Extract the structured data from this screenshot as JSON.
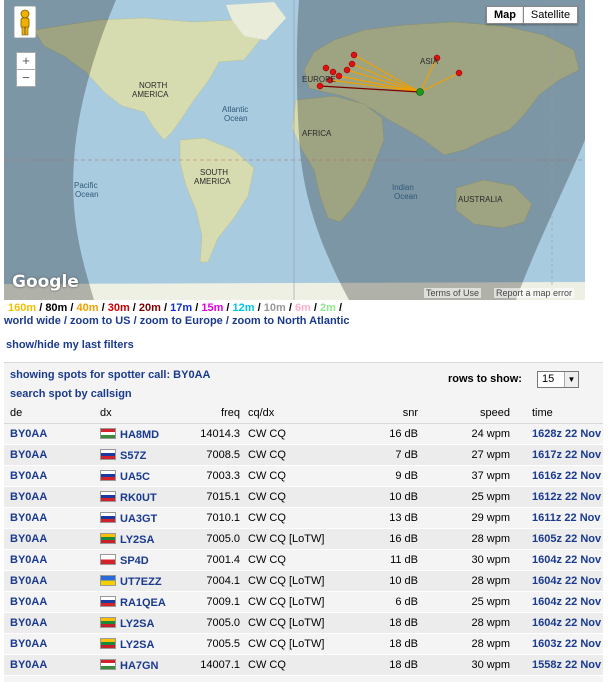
{
  "map": {
    "controls": {
      "map_label": "Map",
      "satellite_label": "Satellite",
      "zoom_in": "+",
      "zoom_out": "−"
    },
    "labels": {
      "north_america": "NORTH\nAMERICA",
      "atlantic_ocean": "Atlantic\nOcean",
      "south_america": "SOUTH\nAMERICA",
      "pacific_ocean": "Pacific\nOcean",
      "europe": "EUROPE",
      "africa": "AFRICA",
      "asia": "ASIA",
      "indian_ocean": "Indian\nOcean",
      "australia": "AUSTRALIA"
    },
    "logo_text": "Google",
    "terms": "Terms of Use",
    "report": "Report a map error"
  },
  "bands": [
    {
      "label": "160m",
      "color": "#f0c000"
    },
    {
      "label": "80m",
      "color": "#000000"
    },
    {
      "label": "40m",
      "color": "#f0a000"
    },
    {
      "label": "30m",
      "color": "#cc0000"
    },
    {
      "label": "20m",
      "color": "#7a0000"
    },
    {
      "label": "17m",
      "color": "#1030c0"
    },
    {
      "label": "15m",
      "color": "#e000e0"
    },
    {
      "label": "12m",
      "color": "#00c8e8"
    },
    {
      "label": "10m",
      "color": "#999999"
    },
    {
      "label": "6m",
      "color": "#ffb0c8"
    },
    {
      "label": "2m",
      "color": "#90e890"
    }
  ],
  "zoom_links": [
    "world wide",
    "zoom to US",
    "zoom to Europe",
    "zoom to North Atlantic"
  ],
  "filters_link": "show/hide my last filters",
  "panel": {
    "showing_spots": "showing spots for spotter call: BY0AA",
    "search_link": "search spot by callsign",
    "rows_label": "rows to show:",
    "rows_value": "15"
  },
  "table": {
    "headers": {
      "de": "de",
      "dx": "dx",
      "freq": "freq",
      "cq": "cq/dx",
      "snr": "snr",
      "speed": "speed",
      "time": "time"
    },
    "rows": [
      {
        "de": "BY0AA",
        "flag": "hu",
        "dx": "HA8MD",
        "freq": "14014.3",
        "cq": "CW CQ",
        "snr": "16 dB",
        "speed": "24 wpm",
        "time": "1628z 22 Nov"
      },
      {
        "de": "BY0AA",
        "flag": "si",
        "dx": "S57Z",
        "freq": "7008.5",
        "cq": "CW CQ",
        "snr": "7 dB",
        "speed": "27 wpm",
        "time": "1617z 22 Nov"
      },
      {
        "de": "BY0AA",
        "flag": "ru",
        "dx": "UA5C",
        "freq": "7003.3",
        "cq": "CW CQ",
        "snr": "9 dB",
        "speed": "37 wpm",
        "time": "1616z 22 Nov"
      },
      {
        "de": "BY0AA",
        "flag": "ru",
        "dx": "RK0UT",
        "freq": "7015.1",
        "cq": "CW CQ",
        "snr": "10 dB",
        "speed": "25 wpm",
        "time": "1612z 22 Nov"
      },
      {
        "de": "BY0AA",
        "flag": "ru",
        "dx": "UA3GT",
        "freq": "7010.1",
        "cq": "CW CQ",
        "snr": "13 dB",
        "speed": "29 wpm",
        "time": "1611z 22 Nov"
      },
      {
        "de": "BY0AA",
        "flag": "lt",
        "dx": "LY2SA",
        "freq": "7005.0",
        "cq": "CW CQ [LoTW]",
        "snr": "16 dB",
        "speed": "28 wpm",
        "time": "1605z 22 Nov"
      },
      {
        "de": "BY0AA",
        "flag": "pl",
        "dx": "SP4D",
        "freq": "7001.4",
        "cq": "CW CQ",
        "snr": "11 dB",
        "speed": "30 wpm",
        "time": "1604z 22 Nov"
      },
      {
        "de": "BY0AA",
        "flag": "ua",
        "dx": "UT7EZZ",
        "freq": "7004.1",
        "cq": "CW CQ [LoTW]",
        "snr": "10 dB",
        "speed": "28 wpm",
        "time": "1604z 22 Nov"
      },
      {
        "de": "BY0AA",
        "flag": "ru",
        "dx": "RA1QEA",
        "freq": "7009.1",
        "cq": "CW CQ [LoTW]",
        "snr": "6 dB",
        "speed": "25 wpm",
        "time": "1604z 22 Nov"
      },
      {
        "de": "BY0AA",
        "flag": "lt",
        "dx": "LY2SA",
        "freq": "7005.0",
        "cq": "CW CQ [LoTW]",
        "snr": "18 dB",
        "speed": "28 wpm",
        "time": "1604z 22 Nov"
      },
      {
        "de": "BY0AA",
        "flag": "lt",
        "dx": "LY2SA",
        "freq": "7005.5",
        "cq": "CW CQ [LoTW]",
        "snr": "18 dB",
        "speed": "28 wpm",
        "time": "1603z 22 Nov"
      },
      {
        "de": "BY0AA",
        "flag": "hu",
        "dx": "HA7GN",
        "freq": "14007.1",
        "cq": "CW CQ",
        "snr": "18 dB",
        "speed": "30 wpm",
        "time": "1558z 22 Nov"
      }
    ]
  },
  "colors": {
    "link": "#1a3a8e",
    "row_odd": "#f4f4f4",
    "row_even": "#ececec",
    "ocean": "#a9cbdf",
    "land": "#d6dcb0"
  }
}
